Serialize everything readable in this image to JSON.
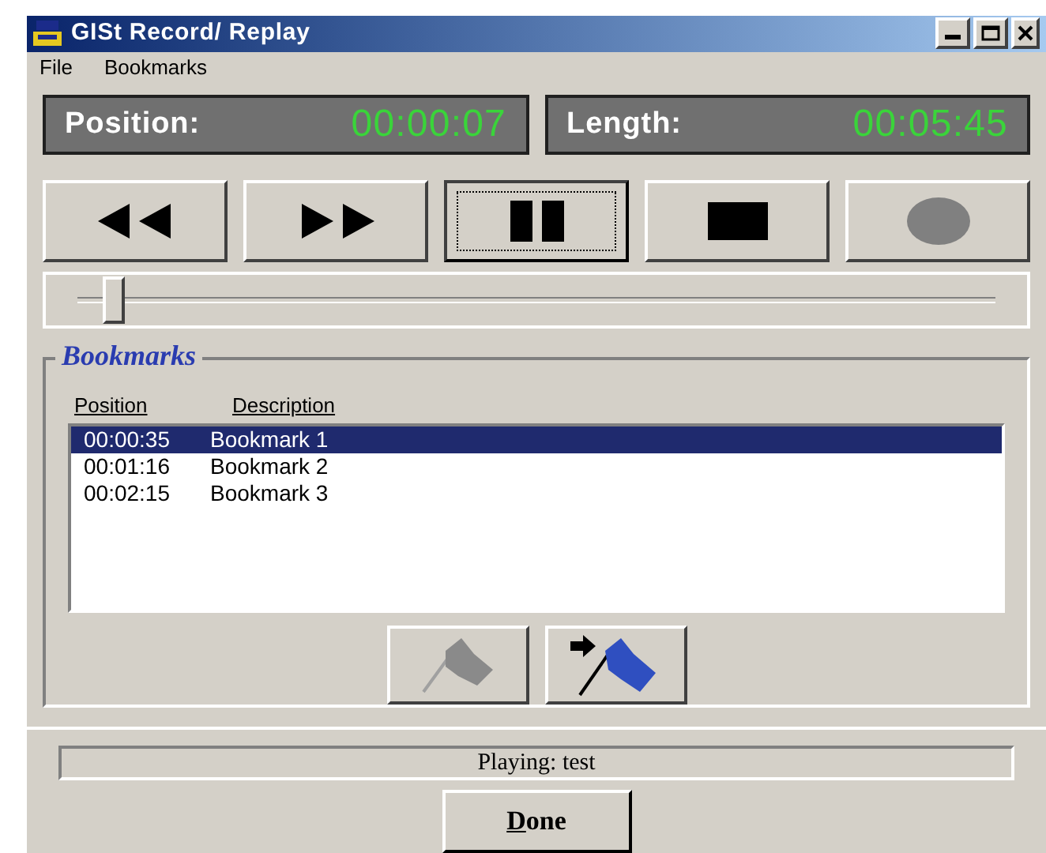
{
  "window": {
    "title": "GISt Record/ Replay"
  },
  "menu": [
    "File",
    "Bookmarks"
  ],
  "position": {
    "label": "Position:",
    "value": "00:00:07"
  },
  "length": {
    "label": "Length:",
    "value": "00:05:45"
  },
  "transport": [
    {
      "kind": "rewind",
      "focused": false,
      "disabled": false
    },
    {
      "kind": "forward",
      "focused": false,
      "disabled": false
    },
    {
      "kind": "pause",
      "focused": true,
      "disabled": false
    },
    {
      "kind": "stop",
      "focused": false,
      "disabled": false
    },
    {
      "kind": "record",
      "focused": false,
      "disabled": true
    }
  ],
  "seek": {
    "level": 0.04
  },
  "bookmarks": {
    "title": "Bookmarks",
    "columns": [
      "Position",
      "Description"
    ],
    "rows": [
      {
        "position": "00:00:35",
        "description": "Bookmark 1",
        "selected": true
      },
      {
        "position": "00:01:16",
        "description": "Bookmark 2",
        "selected": false
      },
      {
        "position": "00:02:15",
        "description": "Bookmark 3",
        "selected": false
      }
    ],
    "actions": [
      {
        "kind": "add",
        "disabled": true
      },
      {
        "kind": "goto",
        "disabled": false
      }
    ]
  },
  "status": "Playing: test",
  "done": "Done"
}
